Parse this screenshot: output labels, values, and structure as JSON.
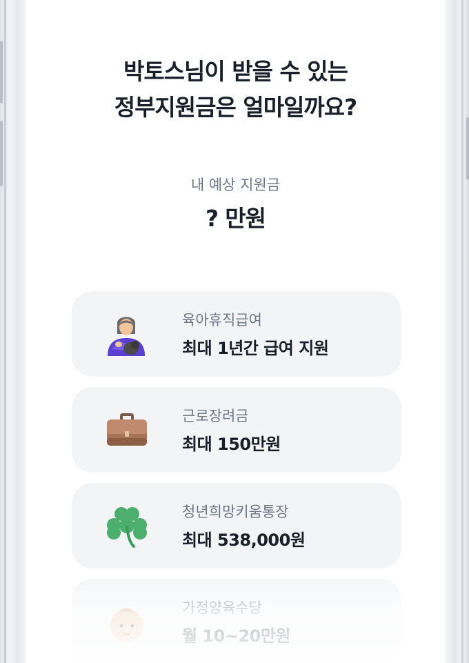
{
  "title": {
    "line1": "박토스님이 받을 수 있는",
    "line2": "정부지원금은 얼마일까요?"
  },
  "estimate": {
    "label": "내 예상 지원금",
    "value_mark": "?",
    "value_unit": "만원"
  },
  "benefits": [
    {
      "name": "육아휴직급여",
      "amount": "최대 1년간 급여 지원",
      "icon": "breastfeeding-mother-icon"
    },
    {
      "name": "근로장려금",
      "amount": "최대 150만원",
      "icon": "briefcase-icon"
    },
    {
      "name": "청년희망키움통장",
      "amount": "최대 538,000원",
      "icon": "clover-icon"
    },
    {
      "name": "가정양육수당",
      "amount": "월 10~20만원",
      "icon": "baby-icon"
    }
  ],
  "colors": {
    "text_primary": "#191f28",
    "text_secondary": "#6b7684",
    "card_bg": "#f2f4f6"
  }
}
